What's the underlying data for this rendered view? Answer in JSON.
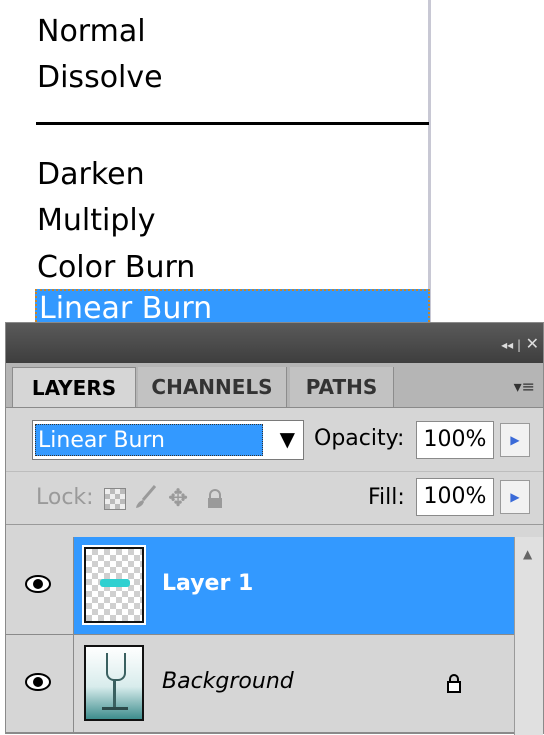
{
  "blend_menu": {
    "options_group1": [
      "Normal",
      "Dissolve"
    ],
    "options_group2": [
      "Darken",
      "Multiply",
      "Color Burn",
      "Linear Burn"
    ],
    "selected": "Linear Burn"
  },
  "panel": {
    "title_controls": {
      "collapse": "◂◂ |",
      "close": "✕"
    },
    "tabs": [
      {
        "label": "LAYERS",
        "active": true
      },
      {
        "label": "CHANNELS",
        "active": false
      },
      {
        "label": "PATHS",
        "active": false
      }
    ],
    "menu_icon": "≡",
    "blend_mode": "Linear Burn",
    "opacity_label": "Opacity:",
    "opacity_value": "100%",
    "lock_label": "Lock:",
    "fill_label": "Fill:",
    "fill_value": "100%",
    "layers": [
      {
        "name": "Layer 1",
        "selected": true,
        "visible": true
      },
      {
        "name": "Background",
        "selected": false,
        "visible": true,
        "locked": true
      }
    ]
  },
  "colors": {
    "selection": "#3399ff",
    "panel_bg": "#d6d6d6"
  }
}
